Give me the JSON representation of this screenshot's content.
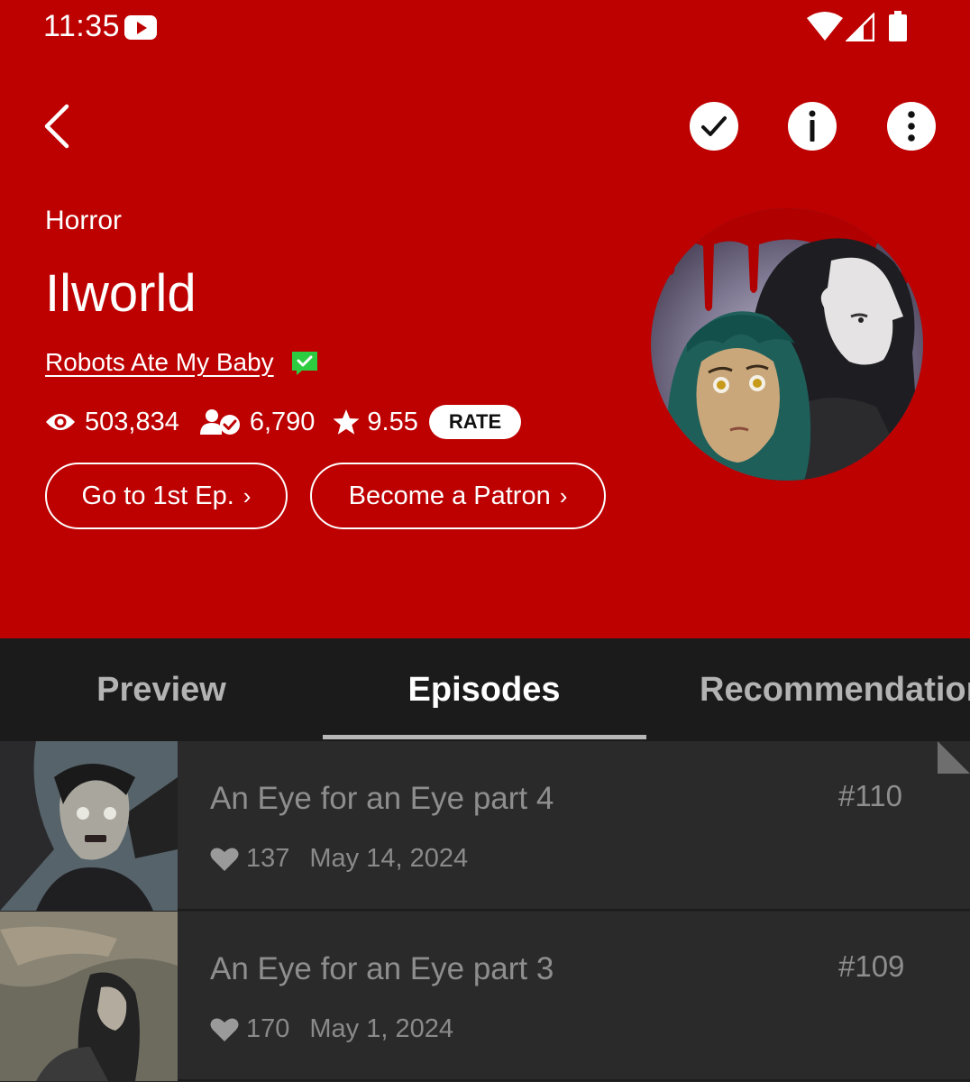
{
  "status_bar": {
    "time": "11:35"
  },
  "header": {
    "genre": "Horror",
    "title": "Ilworld",
    "author": "Robots Ate My Baby"
  },
  "stats": {
    "views": "503,834",
    "subscribers": "6,790",
    "rating": "9.55",
    "rate_label": "RATE"
  },
  "buttons": {
    "first_episode": "Go to 1st Ep.",
    "patron": "Become a Patron"
  },
  "tabs": [
    {
      "label": "Preview",
      "active": false
    },
    {
      "label": "Episodes",
      "active": true
    },
    {
      "label": "Recommendation",
      "active": false
    }
  ],
  "episodes": [
    {
      "title": "An Eye for an Eye part 4",
      "number": "#110",
      "likes": "137",
      "date": "May 14, 2024"
    },
    {
      "title": "An Eye for an Eye part 3",
      "number": "#109",
      "likes": "170",
      "date": "May 1, 2024"
    }
  ],
  "colors": {
    "hero_red": "#bd0000",
    "tab_bar": "#1b1b1b",
    "list_bg": "#2a2a2a",
    "verified_green": "#2ecc40"
  },
  "icons": {
    "back": "chevron-left-icon",
    "subscribe": "check-icon",
    "info": "info-icon",
    "more": "more-vertical-icon",
    "views": "eye-icon",
    "subscribers": "subscriber-icon",
    "rating": "star-icon",
    "likes": "heart-icon"
  }
}
